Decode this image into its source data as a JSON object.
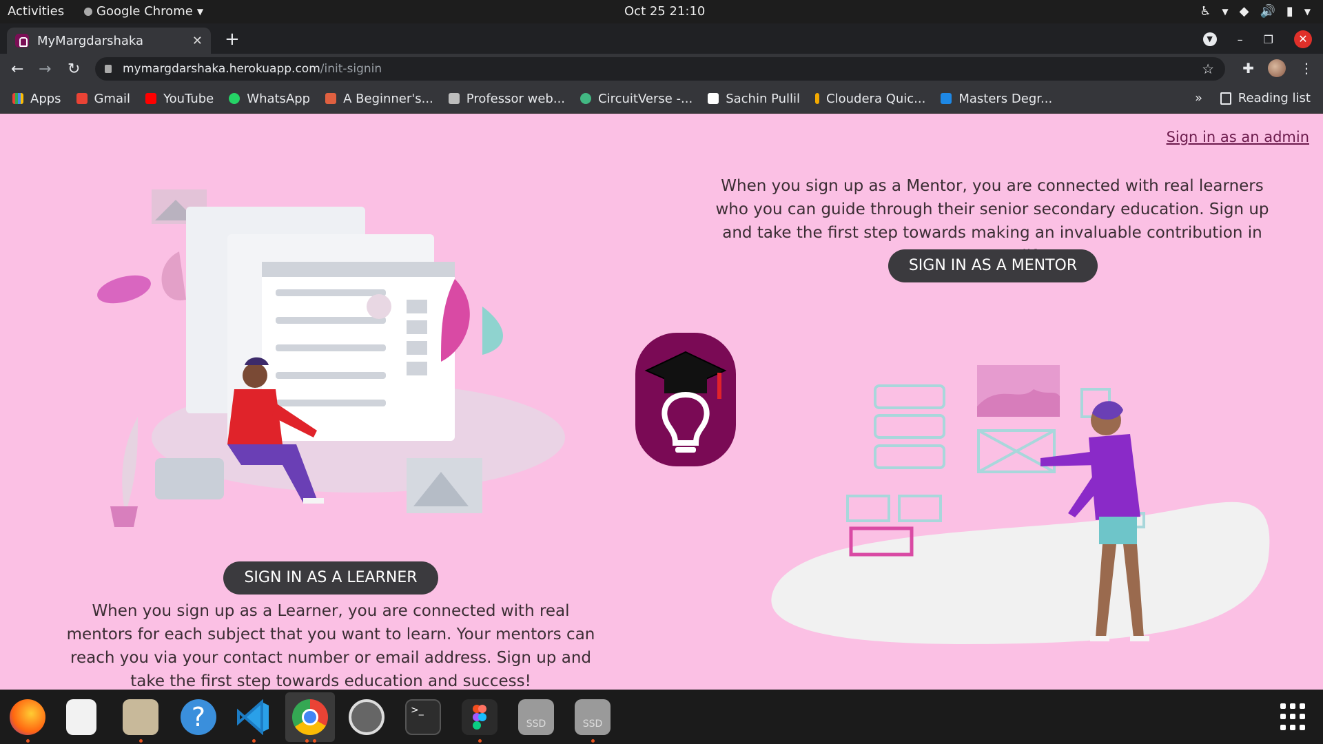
{
  "system_bar": {
    "activities": "Activities",
    "app_name": "Google Chrome",
    "clock": "Oct 25  21:10"
  },
  "browser": {
    "tab_title": "MyMargdarshaka",
    "url_host": "mymargdarshaka.herokuapp.com",
    "url_path": "/init-signin",
    "bookmarks": [
      {
        "label": "Apps",
        "color": "#4285f4"
      },
      {
        "label": "Gmail",
        "color": "#ea4335"
      },
      {
        "label": "YouTube",
        "color": "#ff0000"
      },
      {
        "label": "WhatsApp",
        "color": "#25d366"
      },
      {
        "label": "A Beginner's...",
        "color": "#e06040"
      },
      {
        "label": "Professor web...",
        "color": "#bdbdbd"
      },
      {
        "label": "CircuitVerse -...",
        "color": "#42b883"
      },
      {
        "label": "Sachin Pullil",
        "color": "#ffffff"
      },
      {
        "label": "Cloudera Quic...",
        "color": "#f2a900"
      },
      {
        "label": "Masters Degr...",
        "color": "#1e88e5"
      }
    ],
    "bookmarks_more": "»",
    "reading_list": "Reading list"
  },
  "page": {
    "admin_link": "Sign in as an admin",
    "mentor_text": "When you sign up as a Mentor, you are connected with real learners who you can guide through their senior secondary education. Sign up and take the first step towards making an invaluable contribution in someone's life!",
    "mentor_button": "SIGN IN AS A MENTOR",
    "learner_button": "SIGN IN AS A LEARNER",
    "learner_text": "When you sign up as a Learner, you are connected with real mentors for each subject that you want to learn. Your mentors can reach you via your contact number or email address. Sign up and take the first step towards education and success!",
    "colors": {
      "background": "#fbc0e4",
      "button": "#3b3a3e",
      "logo": "#7a0a55",
      "link": "#6b1a4b"
    }
  },
  "dock": {
    "apps": [
      "firefox-icon",
      "text-editor-icon",
      "files-icon",
      "help-icon",
      "vscode-icon",
      "chrome-icon",
      "settings-icon",
      "terminal-icon",
      "figma-icon",
      "ssd-drive-icon",
      "ssd-drive-icon"
    ],
    "ssd_label": "SSD"
  }
}
